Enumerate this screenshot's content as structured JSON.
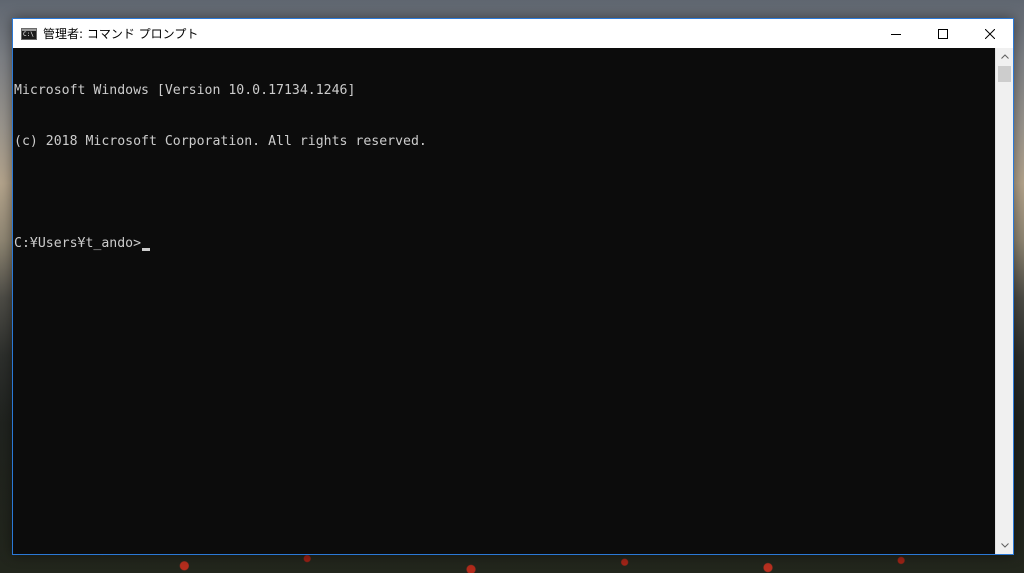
{
  "window": {
    "title": "管理者: コマンド プロンプト",
    "app_icon_glyph": "C:\\",
    "caption": {
      "minimize_icon": "minimize-icon",
      "maximize_icon": "maximize-icon",
      "close_icon": "close-icon"
    }
  },
  "console": {
    "lines": [
      "Microsoft Windows [Version 10.0.17134.1246]",
      "(c) 2018 Microsoft Corporation. All rights reserved.",
      ""
    ],
    "prompt": "C:¥Users¥t_ando>",
    "input_value": ""
  },
  "colors": {
    "console_bg": "#0c0c0c",
    "console_fg": "#cccccc",
    "window_border": "#2b79d6"
  }
}
